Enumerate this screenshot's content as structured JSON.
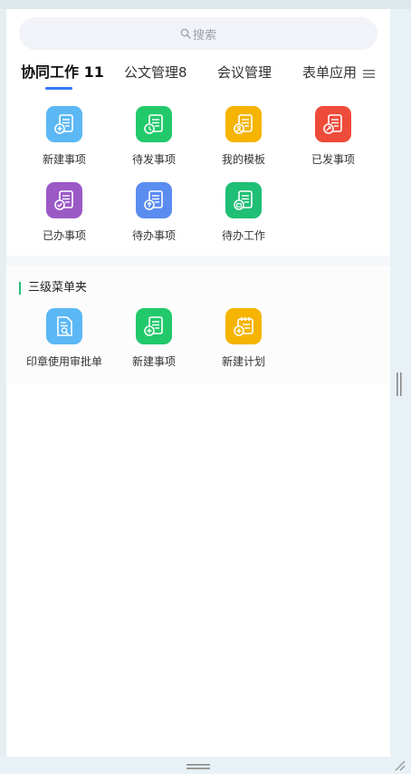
{
  "search": {
    "placeholder": "搜索"
  },
  "tabs": [
    {
      "label": "协同工作 11",
      "active": true
    },
    {
      "label": "公文管理8",
      "active": false
    },
    {
      "label": "会议管理",
      "active": false
    },
    {
      "label": "表单应用",
      "active": false
    }
  ],
  "main_grid": [
    {
      "label": "新建事项",
      "icon": "new-item-icon",
      "color": "#5bb8f5"
    },
    {
      "label": "待发事项",
      "icon": "pending-send-icon",
      "color": "#22c96b"
    },
    {
      "label": "我的模板",
      "icon": "template-icon",
      "color": "#f5b400"
    },
    {
      "label": "已发事项",
      "icon": "sent-item-icon",
      "color": "#ef4b3a"
    },
    {
      "label": "已办事项",
      "icon": "done-item-icon",
      "color": "#9b59c6"
    },
    {
      "label": "待办事项",
      "icon": "todo-item-icon",
      "color": "#5b8cf0"
    },
    {
      "label": "待办工作",
      "icon": "todo-work-icon",
      "color": "#1fbf75"
    }
  ],
  "section2": {
    "title": "三级菜单夹",
    "items": [
      {
        "label": "印章使用审批单",
        "icon": "seal-approval-icon",
        "color": "#5bb8f5"
      },
      {
        "label": "新建事项",
        "icon": "new-item-icon",
        "color": "#22c96b"
      },
      {
        "label": "新建计划",
        "icon": "new-plan-icon",
        "color": "#f5b400"
      }
    ]
  },
  "colors": {
    "accent": "#3478f6",
    "section_marker": "#1fbf75"
  }
}
